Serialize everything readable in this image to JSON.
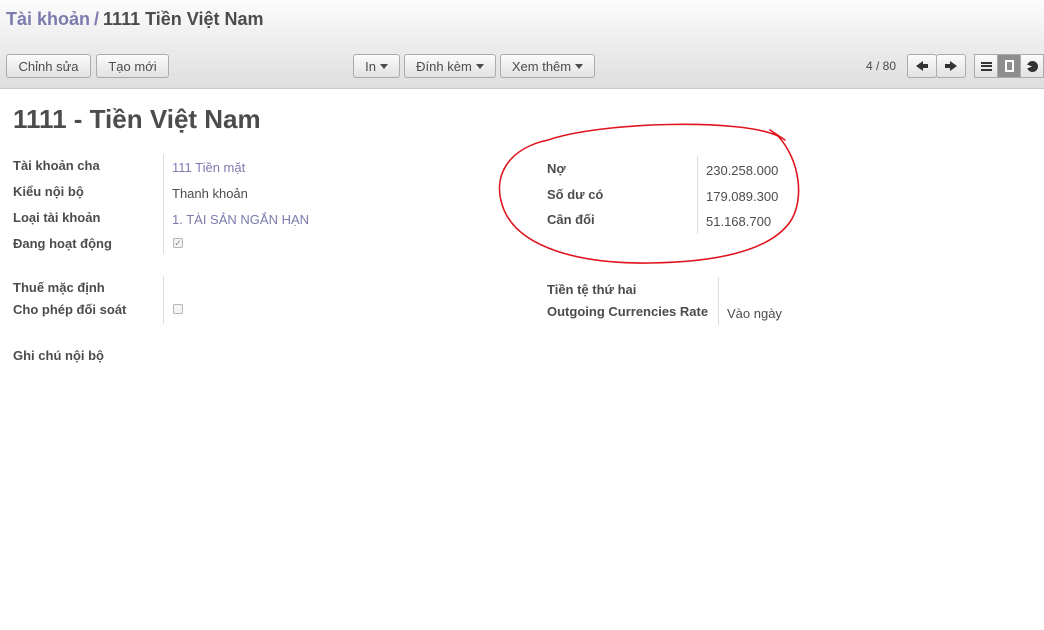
{
  "breadcrumb": {
    "parent": "Tài khoản",
    "separator": "/",
    "current": "1111 Tiền Việt Nam"
  },
  "toolbar": {
    "edit_label": "Chỉnh sửa",
    "create_label": "Tạo mới",
    "print_label": "In",
    "attach_label": "Đính kèm",
    "more_label": "Xem thêm"
  },
  "pager": {
    "count": "4 / 80"
  },
  "record": {
    "title": "1111 - Tiền Việt Nam",
    "left": {
      "parent_account_label": "Tài khoản cha",
      "parent_account_value": "111 Tiền mặt",
      "internal_type_label": "Kiểu nội bộ",
      "internal_type_value": "Thanh khoản",
      "account_type_label": "Loại tài khoản",
      "account_type_value": "1. TÀI SẢN NGẮN HẠN",
      "active_label": "Đang hoạt động",
      "active_checked": true,
      "default_tax_label": "Thuế mặc định",
      "reconcile_label": "Cho phép đối soát",
      "reconcile_checked": false,
      "internal_note_label": "Ghi chú nội bộ"
    },
    "right": {
      "debit_label": "Nợ",
      "debit_value": "230.258.000",
      "credit_label": "Số dư có",
      "credit_value": "179.089.300",
      "balance_label": "Cân đối",
      "balance_value": "51.168.700",
      "secondary_currency_label": "Tiền tệ thứ hai",
      "outgoing_rate_label": "Outgoing Currencies Rate",
      "outgoing_rate_value": "Vào ngày"
    }
  },
  "colors": {
    "link": "#7c7bad",
    "text": "#4c4c4c",
    "annotation": "#e0141e"
  },
  "icons": [
    "arrow-left-icon",
    "arrow-right-icon",
    "list-view-icon",
    "form-view-icon",
    "graph-view-icon",
    "checkmark-icon"
  ]
}
